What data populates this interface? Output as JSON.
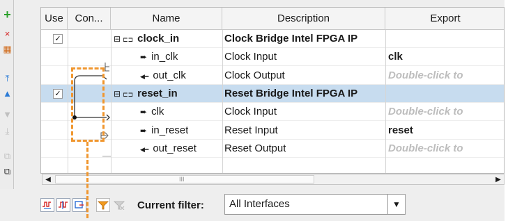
{
  "toolbar": {
    "buttons": [
      {
        "name": "add-icon",
        "glyph": "+",
        "color": "#2aa12a",
        "disabled": false
      },
      {
        "name": "remove-icon",
        "glyph": "×",
        "color": "#d42424",
        "disabled": false
      },
      {
        "name": "edit-icon",
        "glyph": "▦",
        "color": "#d06a1a",
        "disabled": false
      },
      {
        "name": "move-top-icon",
        "glyph": "⤒",
        "color": "#2b7bd6",
        "disabled": false
      },
      {
        "name": "move-up-icon",
        "glyph": "▲",
        "color": "#2b7bd6",
        "disabled": false
      },
      {
        "name": "move-down-icon",
        "glyph": "▼",
        "color": "#8a8a8a",
        "disabled": true
      },
      {
        "name": "move-bottom-icon",
        "glyph": "⤓",
        "color": "#8a8a8a",
        "disabled": true
      },
      {
        "name": "duplicate-icon",
        "glyph": "⧉",
        "color": "#8a8a8a",
        "disabled": true
      },
      {
        "name": "copy-icon",
        "glyph": "⧉",
        "color": "#333333",
        "disabled": false
      }
    ]
  },
  "table": {
    "columns": [
      "Use",
      "Con...",
      "Name",
      "Description",
      "Export"
    ],
    "rows": [
      {
        "use": true,
        "tree": "⊟",
        "icon": "bridge",
        "name": "clock_in",
        "bold": true,
        "description": "Clock Bridge Intel FPGA IP",
        "descBold": true,
        "export": "",
        "exportStyle": "",
        "selected": false
      },
      {
        "use": null,
        "tree": "",
        "icon": "in",
        "name": "in_clk",
        "bold": false,
        "description": "Clock Input",
        "descBold": false,
        "export": "clk",
        "exportStyle": "bold",
        "selected": false
      },
      {
        "use": null,
        "tree": "",
        "icon": "out",
        "name": "out_clk",
        "bold": false,
        "description": "Clock Output",
        "descBold": false,
        "export": "Double-click to",
        "exportStyle": "hint",
        "selected": false
      },
      {
        "use": true,
        "tree": "⊟",
        "icon": "bridge",
        "name": "reset_in",
        "bold": true,
        "description": "Reset Bridge Intel FPGA IP",
        "descBold": true,
        "export": "",
        "exportStyle": "",
        "selected": true
      },
      {
        "use": null,
        "tree": "",
        "icon": "in",
        "name": "clk",
        "bold": false,
        "description": "Clock Input",
        "descBold": false,
        "export": "Double-click to",
        "exportStyle": "hint",
        "selected": false
      },
      {
        "use": null,
        "tree": "",
        "icon": "in",
        "name": "in_reset",
        "bold": false,
        "description": "Reset Input",
        "descBold": false,
        "export": "reset",
        "exportStyle": "bold",
        "selected": false
      },
      {
        "use": null,
        "tree": "",
        "icon": "out",
        "name": "out_reset",
        "bold": false,
        "description": "Reset Output",
        "descBold": false,
        "export": "Double-click to",
        "exportStyle": "hint",
        "selected": false
      }
    ]
  },
  "scrollbar": {
    "left_arrow": "◀",
    "right_arrow": "▶",
    "grip": "III"
  },
  "filter": {
    "label": "Current filter:",
    "value": "All Interfaces",
    "dropdown_glyph": "▼"
  },
  "colors": {
    "selection": "#c7dcef",
    "highlight_dash": "#f0962e",
    "accent": "#2b7bd6"
  }
}
